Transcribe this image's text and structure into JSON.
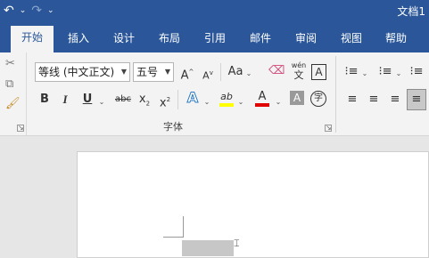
{
  "window": {
    "title": "文档1"
  },
  "qat": {
    "undo_icon": "↶",
    "undo_menu": "⌄",
    "redo_icon": "↷",
    "customize": "⌄"
  },
  "tabs": [
    {
      "label": "开始",
      "active": true
    },
    {
      "label": "插入"
    },
    {
      "label": "设计"
    },
    {
      "label": "布局"
    },
    {
      "label": "引用"
    },
    {
      "label": "邮件"
    },
    {
      "label": "审阅"
    },
    {
      "label": "视图"
    },
    {
      "label": "帮助"
    }
  ],
  "font": {
    "name": "等线 (中文正文)",
    "size": "五号",
    "grow": "A",
    "shrink": "A",
    "case": "Aa",
    "clear_format": "⌫",
    "phonetic_top": "wén",
    "phonetic_bottom": "文",
    "border_char": "A",
    "bold": "B",
    "italic": "I",
    "underline": "U",
    "strike": "abc",
    "subscript": "x",
    "superscript": "x",
    "text_effect": "A",
    "highlight": "ab",
    "font_color": "A",
    "char_shading": "A",
    "enclose": "字",
    "group_label": "字体"
  },
  "colors": {
    "ribbon_blue": "#2b579a",
    "highlight": "#ffff00",
    "font_color": "#e00000"
  }
}
